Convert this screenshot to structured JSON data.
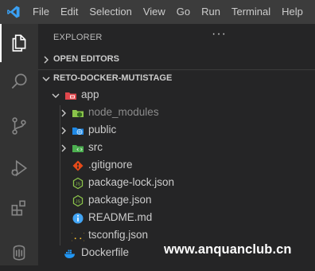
{
  "menu": [
    "File",
    "Edit",
    "Selection",
    "View",
    "Go",
    "Run",
    "Terminal",
    "Help"
  ],
  "activity_bar": {
    "icons": [
      "files-icon",
      "search-icon",
      "source-control-icon",
      "run-debug-icon",
      "extensions-icon",
      "database-icon"
    ]
  },
  "sidebar": {
    "title": "EXPLORER",
    "more": "···",
    "open_editors": "OPEN EDITORS",
    "project": "RETO-DOCKER-MUTISTAGE"
  },
  "tree": [
    {
      "name": "app",
      "type": "folder",
      "expanded": true,
      "icon": "folder-app-icon"
    },
    {
      "name": "node_modules",
      "type": "folder",
      "expanded": false,
      "icon": "folder-node-icon"
    },
    {
      "name": "public",
      "type": "folder",
      "expanded": false,
      "icon": "folder-public-icon"
    },
    {
      "name": "src",
      "type": "folder",
      "expanded": false,
      "icon": "folder-src-icon"
    },
    {
      "name": ".gitignore",
      "type": "file",
      "icon": "git-icon"
    },
    {
      "name": "package-lock.json",
      "type": "file",
      "icon": "nodejs-icon"
    },
    {
      "name": "package.json",
      "type": "file",
      "icon": "nodejs-icon"
    },
    {
      "name": "README.md",
      "type": "file",
      "icon": "info-icon"
    },
    {
      "name": "tsconfig.json",
      "type": "file",
      "icon": "json-braces-icon"
    },
    {
      "name": "Dockerfile",
      "type": "file",
      "icon": "docker-icon"
    }
  ],
  "watermark": "www.anquanclub.cn",
  "colors": {
    "accent": "#0078d4",
    "titlebar": "#3c3c3c",
    "activitybar": "#333333",
    "sidebar": "#252526"
  }
}
